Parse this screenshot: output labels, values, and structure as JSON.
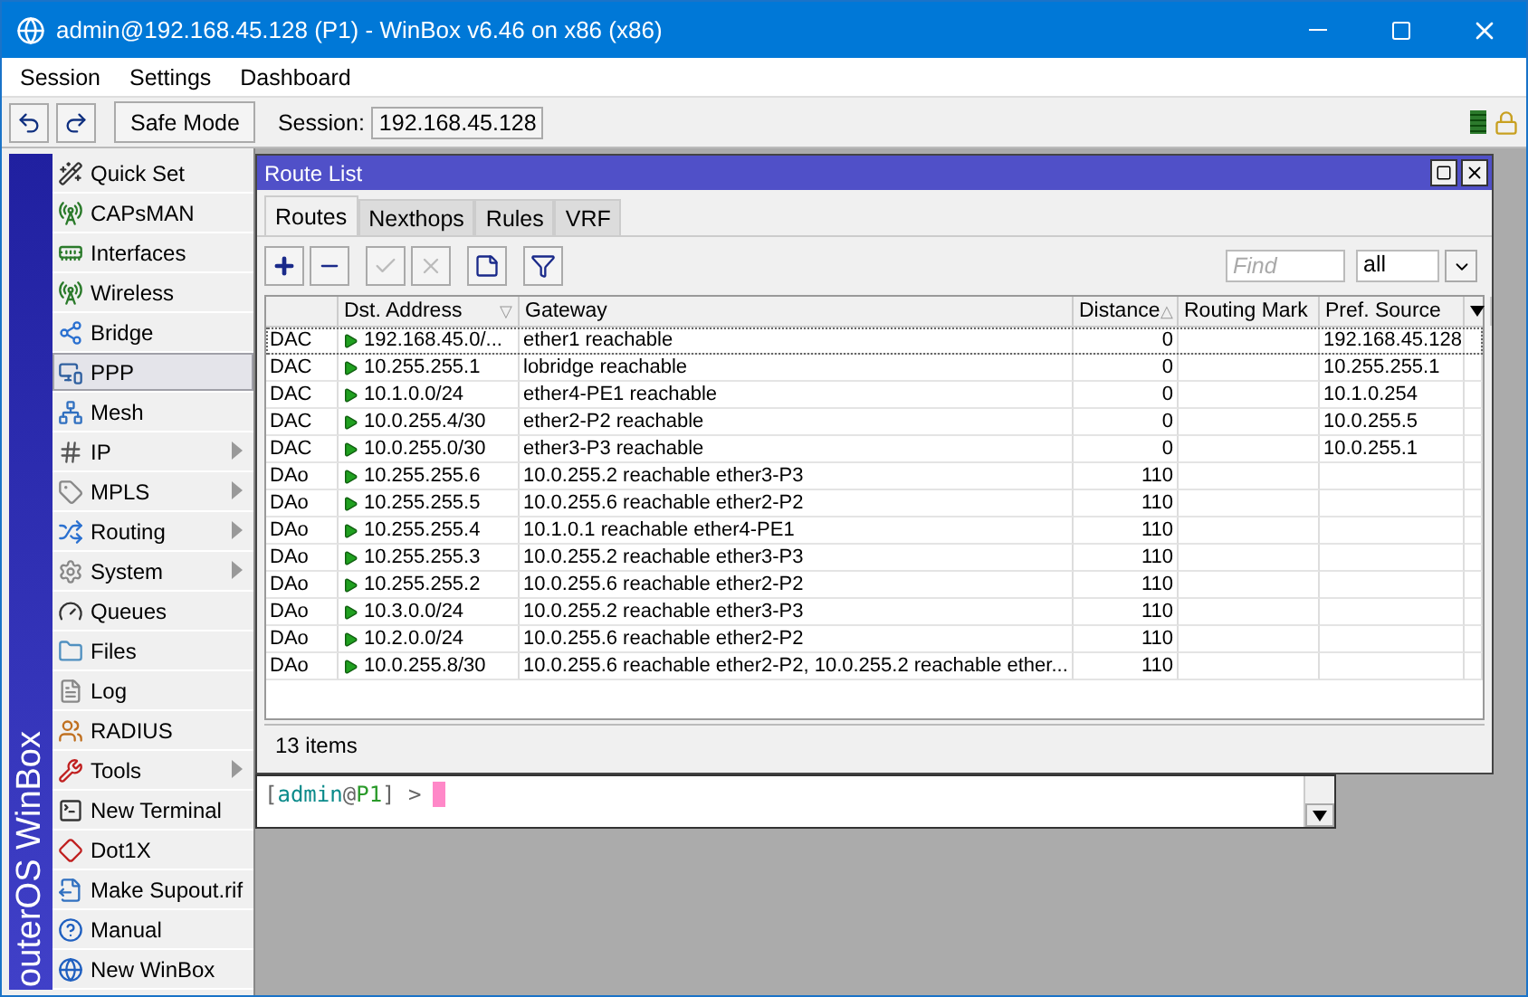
{
  "window": {
    "title": "admin@192.168.45.128 (P1) - WinBox v6.46 on x86 (x86)"
  },
  "menu": [
    "Session",
    "Settings",
    "Dashboard"
  ],
  "toolbar": {
    "safe_mode": "Safe Mode",
    "session_label": "Session:",
    "session_value": "192.168.45.128"
  },
  "sidebar": {
    "brand": "outerOS WinBox",
    "items": [
      {
        "label": "Quick Set",
        "submenu": false,
        "selected": false
      },
      {
        "label": "CAPsMAN",
        "submenu": false,
        "selected": false
      },
      {
        "label": "Interfaces",
        "submenu": false,
        "selected": false
      },
      {
        "label": "Wireless",
        "submenu": false,
        "selected": false
      },
      {
        "label": "Bridge",
        "submenu": false,
        "selected": false
      },
      {
        "label": "PPP",
        "submenu": false,
        "selected": true
      },
      {
        "label": "Mesh",
        "submenu": false,
        "selected": false
      },
      {
        "label": "IP",
        "submenu": true,
        "selected": false
      },
      {
        "label": "MPLS",
        "submenu": true,
        "selected": false
      },
      {
        "label": "Routing",
        "submenu": true,
        "selected": false
      },
      {
        "label": "System",
        "submenu": true,
        "selected": false
      },
      {
        "label": "Queues",
        "submenu": false,
        "selected": false
      },
      {
        "label": "Files",
        "submenu": false,
        "selected": false
      },
      {
        "label": "Log",
        "submenu": false,
        "selected": false
      },
      {
        "label": "RADIUS",
        "submenu": false,
        "selected": false
      },
      {
        "label": "Tools",
        "submenu": true,
        "selected": false
      },
      {
        "label": "New Terminal",
        "submenu": false,
        "selected": false
      },
      {
        "label": "Dot1X",
        "submenu": false,
        "selected": false
      },
      {
        "label": "Make Supout.rif",
        "submenu": false,
        "selected": false
      },
      {
        "label": "Manual",
        "submenu": false,
        "selected": false
      },
      {
        "label": "New WinBox",
        "submenu": false,
        "selected": false
      }
    ]
  },
  "route_list": {
    "title": "Route List",
    "tabs": [
      {
        "label": "Routes",
        "selected": true
      },
      {
        "label": "Nexthops",
        "selected": false
      },
      {
        "label": "Rules",
        "selected": false
      },
      {
        "label": "VRF",
        "selected": false
      }
    ],
    "tools": [
      {
        "kind": "add",
        "disabled": false
      },
      {
        "kind": "remove",
        "disabled": false
      },
      {
        "kind": "enable",
        "disabled": true
      },
      {
        "kind": "disable",
        "disabled": true
      },
      {
        "kind": "comment",
        "disabled": false
      },
      {
        "kind": "filter",
        "disabled": false
      }
    ],
    "find": {
      "placeholder": "Find"
    },
    "filter_value": "all",
    "columns": [
      {},
      {
        "label": "Dst. Address",
        "sort_mark": "▽"
      },
      {
        "label": "Gateway"
      },
      {
        "label": "Distance",
        "sort_mark": "△"
      },
      {
        "label": "Routing Mark"
      },
      {
        "label": "Pref. Source"
      }
    ],
    "rows": [
      {
        "flags": "DAC",
        "dst": "192.168.45.0/...",
        "gateway": "ether1 reachable",
        "distance": "0",
        "pref": "192.168.45.128",
        "focused": true
      },
      {
        "flags": "DAC",
        "dst": "10.255.255.1",
        "gateway": "lobridge reachable",
        "distance": "0",
        "pref": "10.255.255.1",
        "focused": false
      },
      {
        "flags": "DAC",
        "dst": "10.1.0.0/24",
        "gateway": "ether4-PE1 reachable",
        "distance": "0",
        "pref": "10.1.0.254",
        "focused": false
      },
      {
        "flags": "DAC",
        "dst": "10.0.255.4/30",
        "gateway": "ether2-P2 reachable",
        "distance": "0",
        "pref": "10.0.255.5",
        "focused": false
      },
      {
        "flags": "DAC",
        "dst": "10.0.255.0/30",
        "gateway": "ether3-P3 reachable",
        "distance": "0",
        "pref": "10.0.255.1",
        "focused": false
      },
      {
        "flags": "DAo",
        "dst": "10.255.255.6",
        "gateway": "10.0.255.2 reachable ether3-P3",
        "distance": "110",
        "focused": false
      },
      {
        "flags": "DAo",
        "dst": "10.255.255.5",
        "gateway": "10.0.255.6 reachable ether2-P2",
        "distance": "110",
        "focused": false
      },
      {
        "flags": "DAo",
        "dst": "10.255.255.4",
        "gateway": "10.1.0.1 reachable ether4-PE1",
        "distance": "110",
        "focused": false
      },
      {
        "flags": "DAo",
        "dst": "10.255.255.3",
        "gateway": "10.0.255.2 reachable ether3-P3",
        "distance": "110",
        "focused": false
      },
      {
        "flags": "DAo",
        "dst": "10.255.255.2",
        "gateway": "10.0.255.6 reachable ether2-P2",
        "distance": "110",
        "focused": false
      },
      {
        "flags": "DAo",
        "dst": "10.3.0.0/24",
        "gateway": "10.0.255.2 reachable ether3-P3",
        "distance": "110",
        "focused": false
      },
      {
        "flags": "DAo",
        "dst": "10.2.0.0/24",
        "gateway": "10.0.255.6 reachable ether2-P2",
        "distance": "110",
        "focused": false
      },
      {
        "flags": "DAo",
        "dst": "10.0.255.8/30",
        "gateway": "10.0.255.6 reachable ether2-P2, 10.0.255.2 reachable ether...",
        "distance": "110",
        "focused": false
      }
    ],
    "status": "13 items"
  },
  "terminal": {
    "prompt": [
      {
        "kind": "punct",
        "text": "["
      },
      {
        "kind": "user",
        "text": "admin"
      },
      {
        "kind": "punct",
        "text": "@"
      },
      {
        "kind": "host",
        "text": "P1"
      },
      {
        "kind": "punct",
        "text": "] >"
      }
    ]
  }
}
